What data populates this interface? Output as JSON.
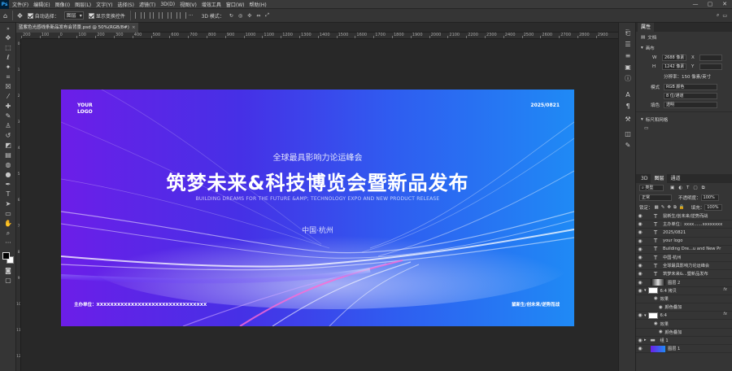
{
  "app": {
    "logo": "Ps"
  },
  "menu": [
    "文件(F)",
    "编辑(E)",
    "图像(I)",
    "图层(L)",
    "文字(Y)",
    "选择(S)",
    "滤镜(T)",
    "3D(D)",
    "视图(V)",
    "增效工具",
    "窗口(W)",
    "帮助(H)"
  ],
  "window_controls": [
    "—",
    "▢",
    "✕"
  ],
  "options": {
    "auto_select_label": "自动选择：",
    "auto_select_value": "图层",
    "transform_label": "显示变换控件",
    "mode_3d_label": "3D 模式："
  },
  "document": {
    "tab_title": "蓝紫色光感线条新品发布会背景.psd @ 50%(RGB/8#)",
    "close": "×"
  },
  "ruler": {
    "h": [
      "200",
      "100",
      "0",
      "100",
      "200",
      "300",
      "400",
      "500",
      "600",
      "700",
      "800",
      "900",
      "1000",
      "1100",
      "1200",
      "1300",
      "1400",
      "1500",
      "1600",
      "1700",
      "1800",
      "1900",
      "2000",
      "2100",
      "2200",
      "2300",
      "2400",
      "2500",
      "2600",
      "2700",
      "2800",
      "2900"
    ],
    "v": [
      "0",
      "1",
      "2",
      "3",
      "4",
      "5",
      "6",
      "7",
      "8",
      "9",
      "10",
      "11",
      "12"
    ]
  },
  "artboard": {
    "logo_line1": "YOUR",
    "logo_line2": "LOGO",
    "date": "2025/0821",
    "subtitle": "全球最具影响力论运峰会",
    "title": "筑梦未来&科技博览会暨新品发布",
    "english": "BUILDING DREAMS FOR THE FUTURE &AMP; TECHNOLOGY EXPO AND NEW PRODUCT RELEASE",
    "location": "中国·杭州",
    "organizer": "主办单位：XXXXXXXXXXXXXXXXXXXXXXXXXXXXXXXX",
    "footer_right": "鼠新生/创未来/逆势而战",
    "colors": {
      "left": "#6c1ee8",
      "right": "#1f8af5"
    }
  },
  "properties_panel": {
    "tabs": [
      "属性"
    ],
    "doc_label": "文档",
    "canvas_label": "画布",
    "w_label": "W",
    "w_value": "2688 像素",
    "x_label": "X",
    "h_label": "H",
    "h_value": "1242 像素",
    "y_label": "Y",
    "resolution": "分辨率：150 像素/英寸",
    "mode_label": "模式",
    "mode_value": "RGB 颜色",
    "depth_value": "8 位/通道",
    "fill_label": "填色",
    "fill_value": "透明",
    "rulers_label": "标尺和网格"
  },
  "layers_panel": {
    "tabs": [
      "3D",
      "图层",
      "通道"
    ],
    "kind_filter": "类型",
    "blend_mode": "正常",
    "opacity_label": "不透明度：",
    "opacity_value": "100%",
    "lock_label": "锁定：",
    "fill_label": "填充：",
    "fill_value": "100%",
    "layers": [
      {
        "name": "鼠新生/创未来/逆势而战",
        "type": "text"
      },
      {
        "name": "主办单位：xxxx……xxxxxxxx",
        "type": "text"
      },
      {
        "name": "2025/0821",
        "type": "text"
      },
      {
        "name": "your logo",
        "type": "text"
      },
      {
        "name": "Building Dre...u and New Pr",
        "type": "text"
      },
      {
        "name": "中国·杭州",
        "type": "text"
      },
      {
        "name": "全球最具影响力论运峰会",
        "type": "text"
      },
      {
        "name": "筑梦未来&...暨新品发布",
        "type": "text"
      },
      {
        "name": "图层 2",
        "type": "image"
      },
      {
        "name": "6:4 拷贝",
        "type": "smart",
        "fx": "fx"
      },
      {
        "name": "效果",
        "type": "effect"
      },
      {
        "name": "颜色叠加",
        "type": "effect-item"
      },
      {
        "name": "6:4",
        "type": "smart",
        "fx": "fx"
      },
      {
        "name": "效果",
        "type": "effect"
      },
      {
        "name": "颜色叠加",
        "type": "effect-item"
      },
      {
        "name": "组 1",
        "type": "group"
      },
      {
        "name": "图层 1",
        "type": "image"
      }
    ]
  }
}
